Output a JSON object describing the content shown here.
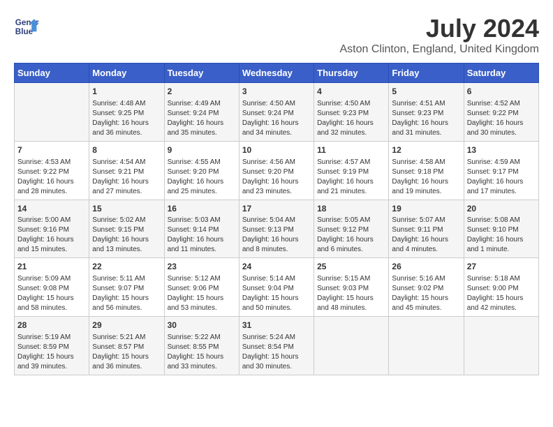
{
  "header": {
    "logo_line1": "General",
    "logo_line2": "Blue",
    "title": "July 2024",
    "subtitle": "Aston Clinton, England, United Kingdom"
  },
  "days_of_week": [
    "Sunday",
    "Monday",
    "Tuesday",
    "Wednesday",
    "Thursday",
    "Friday",
    "Saturday"
  ],
  "weeks": [
    {
      "cells": [
        {
          "day": "",
          "content": ""
        },
        {
          "day": "1",
          "content": "Sunrise: 4:48 AM\nSunset: 9:25 PM\nDaylight: 16 hours\nand 36 minutes."
        },
        {
          "day": "2",
          "content": "Sunrise: 4:49 AM\nSunset: 9:24 PM\nDaylight: 16 hours\nand 35 minutes."
        },
        {
          "day": "3",
          "content": "Sunrise: 4:50 AM\nSunset: 9:24 PM\nDaylight: 16 hours\nand 34 minutes."
        },
        {
          "day": "4",
          "content": "Sunrise: 4:50 AM\nSunset: 9:23 PM\nDaylight: 16 hours\nand 32 minutes."
        },
        {
          "day": "5",
          "content": "Sunrise: 4:51 AM\nSunset: 9:23 PM\nDaylight: 16 hours\nand 31 minutes."
        },
        {
          "day": "6",
          "content": "Sunrise: 4:52 AM\nSunset: 9:22 PM\nDaylight: 16 hours\nand 30 minutes."
        }
      ]
    },
    {
      "cells": [
        {
          "day": "7",
          "content": "Sunrise: 4:53 AM\nSunset: 9:22 PM\nDaylight: 16 hours\nand 28 minutes."
        },
        {
          "day": "8",
          "content": "Sunrise: 4:54 AM\nSunset: 9:21 PM\nDaylight: 16 hours\nand 27 minutes."
        },
        {
          "day": "9",
          "content": "Sunrise: 4:55 AM\nSunset: 9:20 PM\nDaylight: 16 hours\nand 25 minutes."
        },
        {
          "day": "10",
          "content": "Sunrise: 4:56 AM\nSunset: 9:20 PM\nDaylight: 16 hours\nand 23 minutes."
        },
        {
          "day": "11",
          "content": "Sunrise: 4:57 AM\nSunset: 9:19 PM\nDaylight: 16 hours\nand 21 minutes."
        },
        {
          "day": "12",
          "content": "Sunrise: 4:58 AM\nSunset: 9:18 PM\nDaylight: 16 hours\nand 19 minutes."
        },
        {
          "day": "13",
          "content": "Sunrise: 4:59 AM\nSunset: 9:17 PM\nDaylight: 16 hours\nand 17 minutes."
        }
      ]
    },
    {
      "cells": [
        {
          "day": "14",
          "content": "Sunrise: 5:00 AM\nSunset: 9:16 PM\nDaylight: 16 hours\nand 15 minutes."
        },
        {
          "day": "15",
          "content": "Sunrise: 5:02 AM\nSunset: 9:15 PM\nDaylight: 16 hours\nand 13 minutes."
        },
        {
          "day": "16",
          "content": "Sunrise: 5:03 AM\nSunset: 9:14 PM\nDaylight: 16 hours\nand 11 minutes."
        },
        {
          "day": "17",
          "content": "Sunrise: 5:04 AM\nSunset: 9:13 PM\nDaylight: 16 hours\nand 8 minutes."
        },
        {
          "day": "18",
          "content": "Sunrise: 5:05 AM\nSunset: 9:12 PM\nDaylight: 16 hours\nand 6 minutes."
        },
        {
          "day": "19",
          "content": "Sunrise: 5:07 AM\nSunset: 9:11 PM\nDaylight: 16 hours\nand 4 minutes."
        },
        {
          "day": "20",
          "content": "Sunrise: 5:08 AM\nSunset: 9:10 PM\nDaylight: 16 hours\nand 1 minute."
        }
      ]
    },
    {
      "cells": [
        {
          "day": "21",
          "content": "Sunrise: 5:09 AM\nSunset: 9:08 PM\nDaylight: 15 hours\nand 58 minutes."
        },
        {
          "day": "22",
          "content": "Sunrise: 5:11 AM\nSunset: 9:07 PM\nDaylight: 15 hours\nand 56 minutes."
        },
        {
          "day": "23",
          "content": "Sunrise: 5:12 AM\nSunset: 9:06 PM\nDaylight: 15 hours\nand 53 minutes."
        },
        {
          "day": "24",
          "content": "Sunrise: 5:14 AM\nSunset: 9:04 PM\nDaylight: 15 hours\nand 50 minutes."
        },
        {
          "day": "25",
          "content": "Sunrise: 5:15 AM\nSunset: 9:03 PM\nDaylight: 15 hours\nand 48 minutes."
        },
        {
          "day": "26",
          "content": "Sunrise: 5:16 AM\nSunset: 9:02 PM\nDaylight: 15 hours\nand 45 minutes."
        },
        {
          "day": "27",
          "content": "Sunrise: 5:18 AM\nSunset: 9:00 PM\nDaylight: 15 hours\nand 42 minutes."
        }
      ]
    },
    {
      "cells": [
        {
          "day": "28",
          "content": "Sunrise: 5:19 AM\nSunset: 8:59 PM\nDaylight: 15 hours\nand 39 minutes."
        },
        {
          "day": "29",
          "content": "Sunrise: 5:21 AM\nSunset: 8:57 PM\nDaylight: 15 hours\nand 36 minutes."
        },
        {
          "day": "30",
          "content": "Sunrise: 5:22 AM\nSunset: 8:55 PM\nDaylight: 15 hours\nand 33 minutes."
        },
        {
          "day": "31",
          "content": "Sunrise: 5:24 AM\nSunset: 8:54 PM\nDaylight: 15 hours\nand 30 minutes."
        },
        {
          "day": "",
          "content": ""
        },
        {
          "day": "",
          "content": ""
        },
        {
          "day": "",
          "content": ""
        }
      ]
    }
  ]
}
